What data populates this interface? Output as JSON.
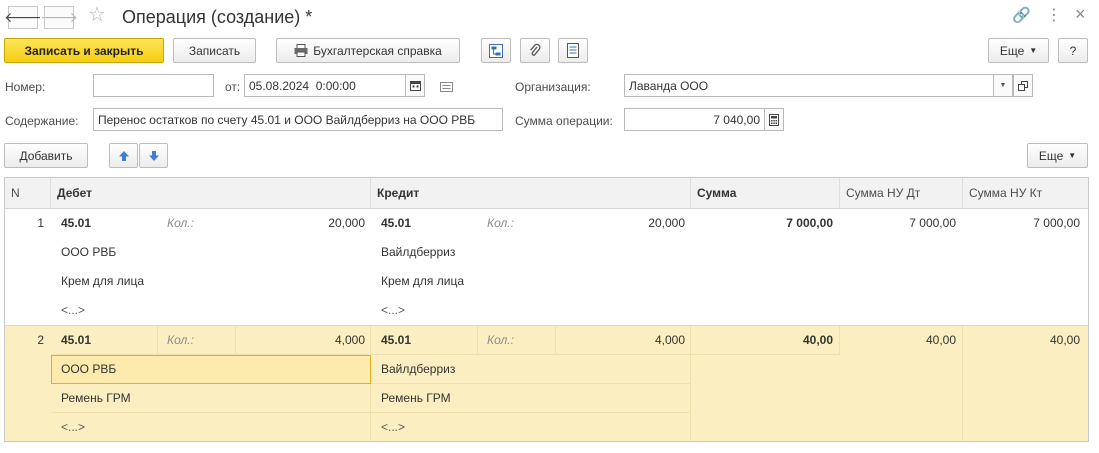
{
  "window": {
    "title": "Операция (создание) *",
    "back_icon": "arrow-left-icon",
    "forward_icon": "arrow-right-icon",
    "favorite_icon": "star-icon",
    "link_icon": "link-icon",
    "menu_icon": "kebab-icon",
    "close_icon": "close-icon",
    "back_glyph": "🡐",
    "forward_glyph": "🡒",
    "star_glyph": "☆",
    "link_glyph": "🔗",
    "menu_glyph": "⋮",
    "close_glyph": "×"
  },
  "toolbar": {
    "save_close_label": "Записать и закрыть",
    "save_label": "Записать",
    "report_label": "Бухгалтерская справка",
    "more_label": "Еще",
    "help_label": "?"
  },
  "form": {
    "number_label": "Номер:",
    "number_value": "",
    "date_label": "от:",
    "date_value": "05.08.2024  0:00:00",
    "org_label": "Организация:",
    "org_value": "Лаванда ООО",
    "content_label": "Содержание:",
    "content_value": "Перенос остатков по счету 45.01 и ООО Вайлдберриз на ООО РВБ",
    "sum_label": "Сумма операции:",
    "sum_value": "7 040,00"
  },
  "table_toolbar": {
    "add_label": "Добавить",
    "more_label": "Еще"
  },
  "table": {
    "columns": {
      "n": "N",
      "debit": "Дебет",
      "credit": "Кредит",
      "sum": "Сумма",
      "sum_nu_dt": "Сумма НУ Дт",
      "sum_nu_kt": "Сумма НУ Кт"
    },
    "rows": [
      {
        "n": "1",
        "dt_account": "45.01",
        "dt_qty_label": "Кол.:",
        "dt_qty": "20,000",
        "dt_sub1": "ООО РВБ",
        "dt_sub2": "Крем для лица",
        "dt_sub3": "<...>",
        "kt_account": "45.01",
        "kt_qty_label": "Кол.:",
        "kt_qty": "20,000",
        "kt_sub1": "Вайлдберриз",
        "kt_sub2": "Крем для лица",
        "kt_sub3": "<...>",
        "sum": "7 000,00",
        "sum_nu_dt": "7 000,00",
        "sum_nu_kt": "7 000,00"
      },
      {
        "n": "2",
        "dt_account": "45.01",
        "dt_qty_label": "Кол.:",
        "dt_qty": "4,000",
        "dt_sub1": "ООО РВБ",
        "dt_sub2": "Ремень ГРМ",
        "dt_sub3": "<...>",
        "kt_account": "45.01",
        "kt_qty_label": "Кол.:",
        "kt_qty": "4,000",
        "kt_sub1": "Вайлдберриз",
        "kt_sub2": "Ремень ГРМ",
        "kt_sub3": "<...>",
        "sum": "40,00",
        "sum_nu_dt": "40,00",
        "sum_nu_kt": "40,00"
      }
    ]
  },
  "colors": {
    "primary_button": "#f6cd10",
    "selected_row": "#fbeec0",
    "focused_cell_border": "#e3b21a"
  }
}
